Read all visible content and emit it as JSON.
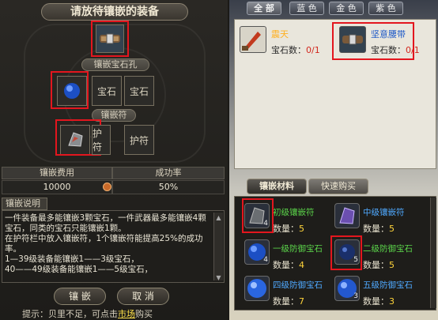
{
  "left": {
    "title": "请放待镶嵌的装备",
    "gem_slots_label": "镶嵌宝石孔",
    "gem_slot_text": [
      "宝石",
      "宝石"
    ],
    "charm_label": "镶嵌符",
    "charm_slot_text": [
      "护符",
      "护符"
    ],
    "cost_header": "镶嵌费用",
    "rate_header": "成功率",
    "cost_value": "10000",
    "rate_value": "50%",
    "desc_tab": "镶嵌说明",
    "desc_lines": [
      "一件装备最多能镶嵌3颗宝石，一件武器最多能镶嵌4颗",
      "宝石，同类的宝石只能镶嵌1颗。",
      "在护符栏中放入镶嵌符，1个镶嵌符能提高25%的成功",
      "率。",
      "1—39级装备能镶嵌1——3级宝石，",
      "40——49级装备能镶嵌1——5级宝石，"
    ],
    "embed_button": "镶 嵌",
    "cancel_button": "取 消",
    "tip_prefix": "提示：贝里不足，可点击",
    "tip_link": "市场",
    "tip_suffix": "购买"
  },
  "right": {
    "tabs": [
      "全 部",
      "蓝 色",
      "金 色",
      "紫 色"
    ],
    "equipment": [
      {
        "name": "震天",
        "gems_label": "宝石数：",
        "gems_count": "0/1"
      },
      {
        "name": "坚意腰带",
        "gems_label": "宝石数：",
        "gems_count": "0/1"
      }
    ],
    "mat_tabs": [
      "镶嵌材料",
      "快速购买"
    ],
    "materials": [
      {
        "name": "初级镶嵌符",
        "count_label": "数量：",
        "count": "5",
        "stack": "4",
        "color": "green"
      },
      {
        "name": "中级镶嵌符",
        "count_label": "数量：",
        "count": "5",
        "stack": "",
        "color": "blue"
      },
      {
        "name": "一级防御宝石",
        "count_label": "数量：",
        "count": "4",
        "stack": "4",
        "color": "green"
      },
      {
        "name": "二级防御宝石",
        "count_label": "数量：",
        "count": "5",
        "stack": "5",
        "color": "green"
      },
      {
        "name": "四级防御宝石",
        "count_label": "数量：",
        "count": "7",
        "stack": "",
        "color": "blue"
      },
      {
        "name": "五级防御宝石",
        "count_label": "数量：",
        "count": "3",
        "stack": "3",
        "color": "blue"
      }
    ]
  },
  "colors": {
    "highlight": "#e3161e",
    "count_red": "#d2281e",
    "link_yellow": "#ffe14a"
  }
}
